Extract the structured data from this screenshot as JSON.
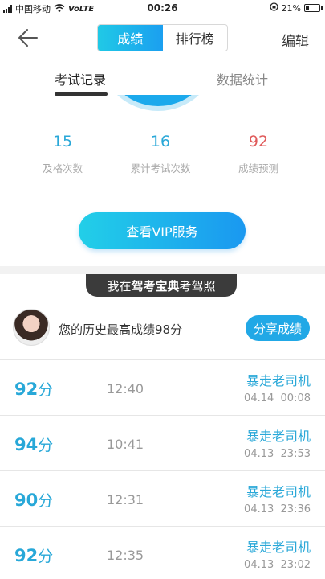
{
  "status_bar": {
    "carrier": "中国移动",
    "network": "VoLTE",
    "time": "00:26",
    "battery": "21%"
  },
  "nav": {
    "tabs": [
      "成绩",
      "排行榜"
    ],
    "active_tab": "成绩",
    "edit_label": "编辑"
  },
  "subtabs": {
    "exam_records": "考试记录",
    "data_stats": "数据统计"
  },
  "stats": [
    {
      "value": "15",
      "label": "及格次数"
    },
    {
      "value": "16",
      "label": "累计考试次数"
    },
    {
      "value": "92",
      "label": "成绩预测"
    }
  ],
  "vip_button": "查看VIP服务",
  "banner": {
    "prefix": "我在",
    "brand": "驾考宝典",
    "suffix": "考驾照"
  },
  "profile": {
    "best_score_text": "您的历史最高成绩98分",
    "share_button": "分享成绩"
  },
  "records": [
    {
      "score": "92",
      "unit": "分",
      "duration": "12:40",
      "title": "暴走老司机",
      "date": "04.14  00:08"
    },
    {
      "score": "94",
      "unit": "分",
      "duration": "10:41",
      "title": "暴走老司机",
      "date": "04.13  23:53"
    },
    {
      "score": "90",
      "unit": "分",
      "duration": "12:31",
      "title": "暴走老司机",
      "date": "04.13  23:36"
    },
    {
      "score": "92",
      "unit": "分",
      "duration": "12:35",
      "title": "暴走老司机",
      "date": "04.13  23:02"
    }
  ],
  "colors": {
    "accent": "#21a8e6",
    "score_prediction": "#e05a5a",
    "banner_bg": "#3b3b3b"
  }
}
